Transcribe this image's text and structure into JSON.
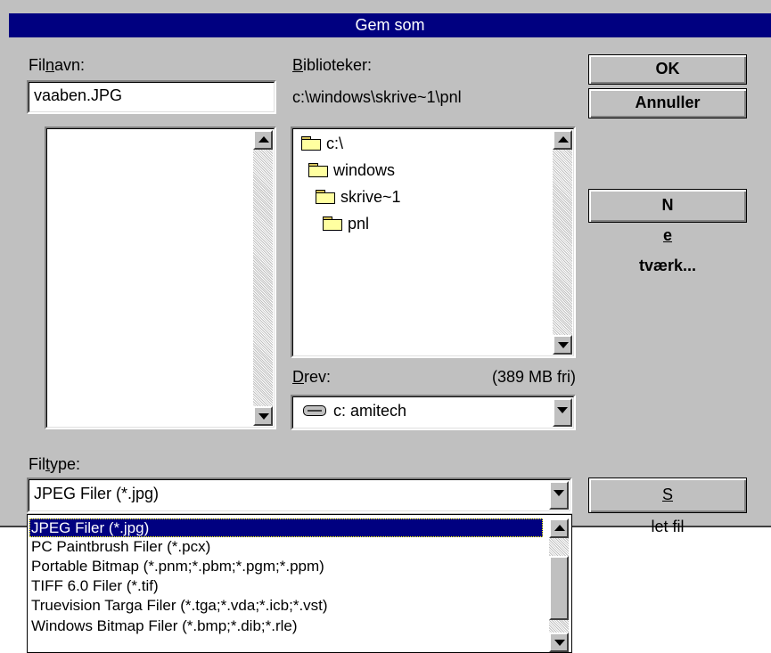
{
  "dialog": {
    "title": "Gem som",
    "filename": {
      "label_pre": "Fil",
      "label_accel": "n",
      "label_post": "avn:",
      "value": "vaaben.JPG"
    },
    "directories": {
      "label_accel": "B",
      "label_post": "iblioteker:",
      "current_path": "c:\\windows\\skrive~1\\pnl",
      "items": [
        "c:\\",
        "windows",
        "skrive~1",
        "pnl"
      ]
    },
    "drives": {
      "label_accel": "D",
      "label_post": "rev:",
      "free_space": "(389 MB fri)",
      "selected": "c: amitech"
    },
    "filetype": {
      "label_pre": "Fil",
      "label_accel": "t",
      "label_post": "ype:",
      "selected": "JPEG Filer (*.jpg)",
      "options": [
        "JPEG Filer (*.jpg)",
        "PC Paintbrush Filer (*.pcx)",
        "Portable Bitmap (*.pnm;*.pbm;*.pgm;*.ppm)",
        "TIFF 6.0 Filer (*.tif)",
        "Truevision Targa Filer (*.tga;*.vda;*.icb;*.vst)",
        "Windows Bitmap Filer (*.bmp;*.dib;*.rle)"
      ]
    },
    "buttons": {
      "ok": "OK",
      "cancel": "Annuller",
      "network_pre": "N",
      "network_accel": "e",
      "network_post": "tværk...",
      "delete_accel": "S",
      "delete_post": "let fil"
    }
  },
  "colors": {
    "titlebar": "#000080",
    "face": "#c0c0c0",
    "selection": "#000080"
  },
  "icons": {
    "folder": "open-folder-icon",
    "drive": "hard-drive-icon",
    "scroll_up": "triangle-up",
    "scroll_down": "triangle-down"
  }
}
